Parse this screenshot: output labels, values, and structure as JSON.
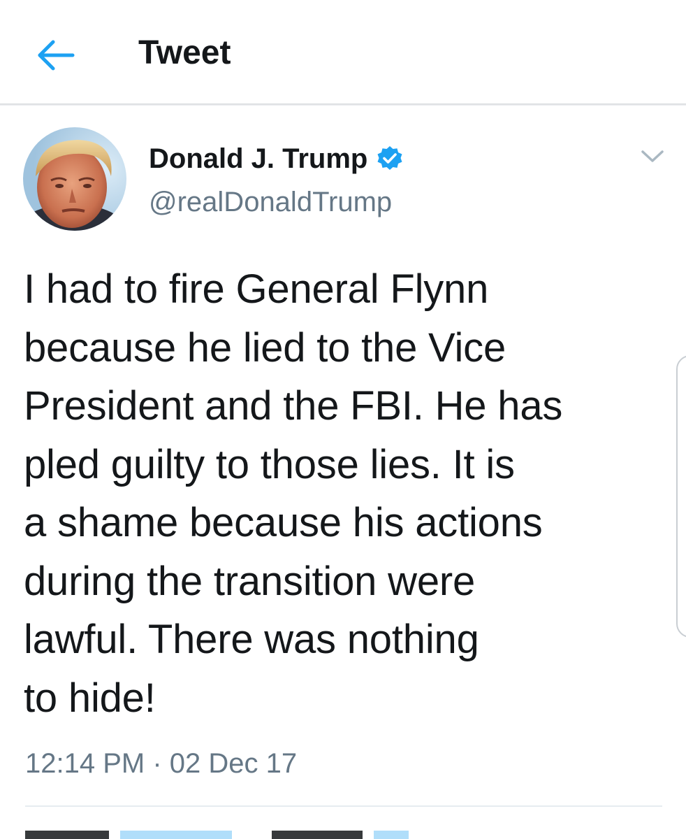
{
  "header": {
    "back_icon": "arrow-left-icon",
    "title": "Tweet"
  },
  "tweet": {
    "author_name": "Donald J. Trump",
    "verified_icon": "verified-badge-icon",
    "handle": "@realDonaldTrump",
    "menu_icon": "chevron-down-icon",
    "text": "I had to fire General Flynn\nbecause he lied to the Vice\nPresident and the FBI. He has\npled guilty to those lies. It is\na shame because his actions\nduring the transition were\nlawful. There was nothing\nto hide!",
    "timestamp": "12:14 PM · 02 Dec 17"
  },
  "colors": {
    "accent": "#1da1f2",
    "text_primary": "#14171a",
    "text_secondary": "#657786",
    "divider": "#e6ecf0"
  }
}
